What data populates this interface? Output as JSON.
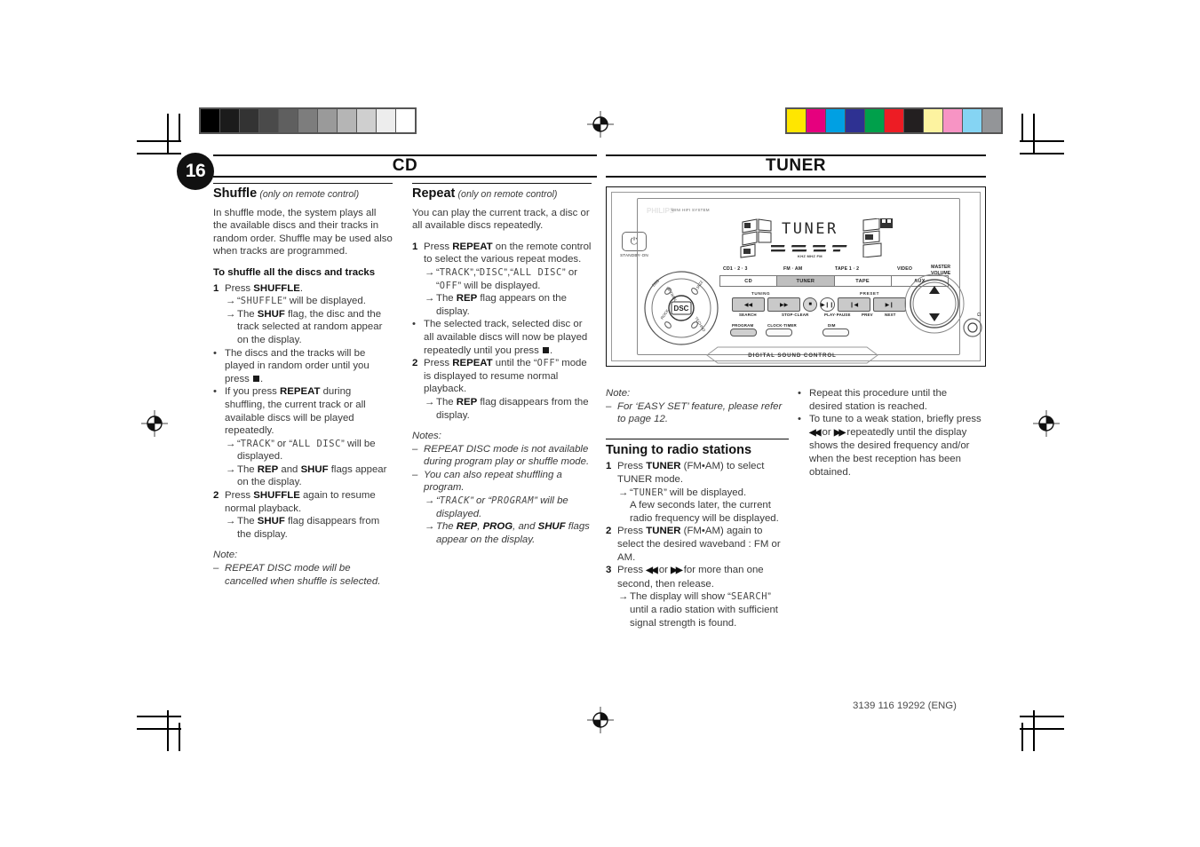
{
  "page": {
    "number": "16",
    "footer_code": "3139 116 19292 (ENG)"
  },
  "headers": {
    "left": "CD",
    "right": "TUNER"
  },
  "calibration": {
    "grayscale": [
      "#000000",
      "#1b1b1b",
      "#333333",
      "#4a4a4a",
      "#5f5f5f",
      "#7d7d7d",
      "#9a9a9a",
      "#b5b5b5",
      "#cfcfcf",
      "#ededed",
      "#ffffff"
    ],
    "colors": [
      "#ffe600",
      "#e6007e",
      "#00a0e3",
      "#2e3192",
      "#00a04b",
      "#ed1c24",
      "#231f20",
      "#fdf3a0",
      "#f794c4",
      "#85d4f3",
      "#939598"
    ]
  },
  "col1": {
    "heading": "Shuffle",
    "heading_sub": "(only on remote control)",
    "intro": "In shuffle mode, the system plays all the available discs and their tracks in random order. Shuffle may be used also when tracks are programmed.",
    "subheading": "To shuffle all the discs and tracks",
    "step1_num": "1",
    "step1_pre": "Press ",
    "step1_bold": "SHUFFLE",
    "step1_post": ".",
    "a1_pre": "“",
    "a1_lcd": "SHUFFLE",
    "a1_post": "” will be displayed.",
    "a2_pre": "The ",
    "a2_bold": "SHUF",
    "a2_post": " flag, the disc and the track selected at random appear on the display.",
    "b1": "The discs and the tracks will be played in random order until you press",
    "b1_end": ".",
    "b2_pre": "If you press ",
    "b2_bold": "REPEAT",
    "b2_post": " during shuffling, the current track or all available discs will be played repeatedly.",
    "b2a_pre": "“",
    "b2a_lcd1": "TRACK",
    "b2a_mid": "” or “",
    "b2a_lcd2": "ALL DISC",
    "b2a_post": "” will be displayed.",
    "b2b_pre": "The ",
    "b2b_bold1": "REP",
    "b2b_mid": " and ",
    "b2b_bold2": "SHUF",
    "b2b_post": " flags appear on the display.",
    "step2_num": "2",
    "step2_pre": "Press ",
    "step2_bold": "SHUFFLE",
    "step2_post": " again to resume normal playback.",
    "c1_pre": "The ",
    "c1_bold": "SHUF",
    "c1_post": " flag disappears from the display.",
    "note_label": "Note:",
    "note_dash": "–",
    "note_text": "REPEAT DISC mode will be cancelled when shuffle is selected."
  },
  "col2": {
    "heading": "Repeat",
    "heading_sub": "(only on remote control)",
    "intro": "You can play the current track, a disc or all available discs repeatedly.",
    "step1_num": "1",
    "step1_pre": "Press ",
    "step1_bold": "REPEAT",
    "step1_post": " on the remote control to select the various repeat modes.",
    "a1_pre": "“",
    "a1_lcd1": "TRACK",
    "a1_m1": "”,“",
    "a1_lcd2": "DISC",
    "a1_m2": "”,“",
    "a1_lcd3": "ALL DISC",
    "a1_m3": "” or “",
    "a1_lcd4": "OFF",
    "a1_post": "” will be displayed.",
    "a2_pre": "The ",
    "a2_bold": "REP",
    "a2_post": " flag appears on the display.",
    "b1": "The selected track, selected disc or all available discs will now be played repeatedly until you press",
    "b1_end": ".",
    "step2_num": "2",
    "step2_pre": "Press ",
    "step2_bold": "REPEAT",
    "step2_mid": " until the “",
    "step2_lcd": "OFF",
    "step2_post": "” mode is displayed to resume normal playback.",
    "c1_pre": "The ",
    "c1_bold": "REP",
    "c1_post": " flag disappears from the display.",
    "notes_label": "Notes:",
    "note1_dash": "–",
    "note1_text": "REPEAT DISC mode is not available during program play or shuffle mode.",
    "note2_dash": "–",
    "note2_text": "You can also repeat shuffling a program.",
    "note2a_pre": "“",
    "note2a_lcd1": "TRACK",
    "note2a_mid": "” or “",
    "note2a_lcd2": "PROGRAM",
    "note2a_post": "” will be displayed.",
    "note2b_pre": "The ",
    "note2b_b1": "REP",
    "note2b_m1": ", ",
    "note2b_b2": "PROG",
    "note2b_m2": ", and ",
    "note2b_b3": "SHUF",
    "note2b_post": " flags appear on the display."
  },
  "col3": {
    "note_label": "Note:",
    "note_dash": "–",
    "note_text": "For ‘EASY SET’ feature, please refer to page 12.",
    "heading": "Tuning to radio stations",
    "step1_num": "1",
    "step1_pre": "Press ",
    "step1_bold": "TUNER",
    "step1_post": " (FM•AM) to select TUNER mode.",
    "a1_pre": "“",
    "a1_lcd": "TUNER",
    "a1_post": "” will be displayed.",
    "a2": "A few seconds later, the current radio frequency will be displayed.",
    "step2_num": "2",
    "step2_pre": "Press ",
    "step2_bold": "TUNER",
    "step2_post": " (FM•AM) again to select the desired waveband : FM or AM.",
    "step3_num": "3",
    "step3_pre": "Press ",
    "step3_mid": " or ",
    "step3_post": " for more than one second, then release.",
    "b1_pre": "The display will show “",
    "b1_lcd": "SEARCH",
    "b1_post": "” until a radio station with sufficient signal strength is found."
  },
  "col4": {
    "bullet1": "Repeat this procedure until the desired station is reached.",
    "bullet2_pre": "To tune to a weak station, briefly press ",
    "bullet2_mid": " or ",
    "bullet2_post": " repeatedly until the display shows the desired frequency and/or when the best reception has been obtained."
  },
  "illustration": {
    "brand_ghost": "PHILIPS",
    "brand_text": "MINI HIFI SYSTEM",
    "standby_label": "STANDBY·ON",
    "standby_icon": "power-icon",
    "display_text": "TUNER",
    "display_mini": "KHZ MHZ FM",
    "source_labels": [
      "CD1 · 2 · 3",
      "FM · AM",
      "TAPE 1 · 2",
      "VIDEO"
    ],
    "source_buttons": [
      "CD",
      "TUNER",
      "TAPE",
      "AUX"
    ],
    "selected_source": "TUNER",
    "master_volume": [
      "MASTER",
      "VOLUME"
    ],
    "tuning_label": "TUNING",
    "preset_label": "PRESET",
    "transport_keys": [
      "◀◀",
      "▶▶",
      "■",
      "▶❙❙",
      "❙◀",
      "▶❙"
    ],
    "transport_sublabels": [
      "SEARCH",
      "STOP·CLEAR",
      "PLAY·PAUSE",
      "PREV",
      "NEXT"
    ],
    "low_keys": [
      "PROGRAM",
      "CLOCK·TIMER",
      "DIM"
    ],
    "dsc_center": "DSC",
    "dsc_modes": [
      "DBB",
      "OPTIMAL",
      "JAZZ",
      "ROCK",
      "TECHNO"
    ],
    "dsc_bar": "DIGITAL SOUND CONTROL",
    "headphone_icon": "headphone-icon"
  }
}
